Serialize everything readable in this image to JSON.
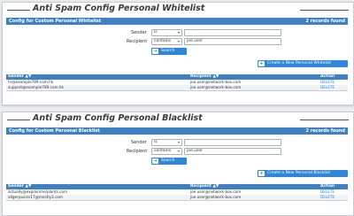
{
  "whitelist": {
    "title": "Anti Spam Config Personal Whitelist",
    "header": "Config for Custom Personal Whitelist",
    "records": "2 records found",
    "sender_label": "Sender",
    "sender_op": "is",
    "sender_value": "",
    "recipient_label": "Recipient",
    "recipient_op": "contains",
    "recipient_value": "joe.user",
    "search_label": "Search",
    "create_label": "Create a New Personal Whitelist",
    "columns": [
      "Sender ▲▼",
      "Recipient ▲▼",
      "Action"
    ],
    "rows": [
      {
        "sender": "hr@example789.com.hk",
        "recipient": "joe.user@network-box.com",
        "action": "DELETE"
      },
      {
        "sender": "support@example789.com.hk",
        "recipient": "joe.user@network-box.com",
        "action": "DELETE"
      }
    ]
  },
  "blacklist": {
    "title": "Anti Spam Config Personal Blacklist",
    "header": "Config for Custom Personal Blacklist",
    "records": "2 records found",
    "sender_label": "Sender",
    "sender_op": "is",
    "sender_value": "",
    "recipient_label": "Recipient",
    "recipient_op": "contains",
    "recipient_value": "joe.user",
    "search_label": "Search",
    "create_label": "Create a New Personal Blacklist",
    "columns": [
      "Sender ▲▼",
      "Recipient ▲▼",
      "Action"
    ],
    "rows": [
      {
        "sender": "actually@explainme/plants.com",
        "recipient": "joe.user@network-box.com",
        "action": "DELETE"
      },
      {
        "sender": "allgerpusins17@mostly3.com",
        "recipient": "joe.user@network-box.com",
        "action": "DELETE"
      }
    ]
  },
  "icons": {
    "dropdown": "chevron-down-icon",
    "search": "arrow-right-icon",
    "add": "plus-icon"
  },
  "colors": {
    "accent": "#3f80c2",
    "button": "#2f86d6",
    "link": "#2f86d6"
  }
}
